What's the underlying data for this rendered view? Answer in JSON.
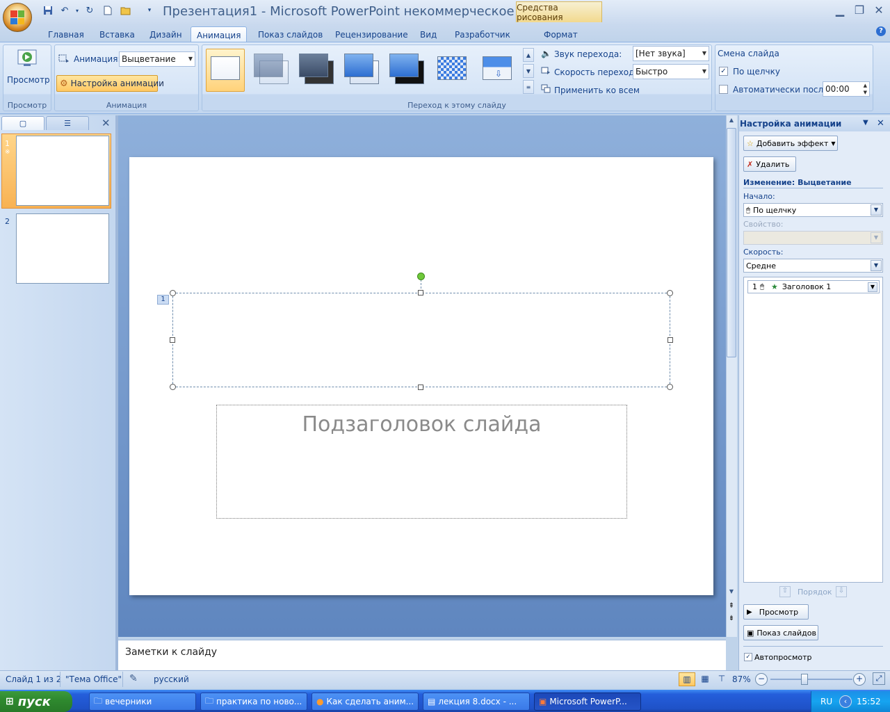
{
  "window": {
    "title": "Презентация1 - Microsoft PowerPoint некоммерческое ...",
    "contextual_tab": "Средства рисования",
    "icons": [
      "save-icon",
      "undo-icon",
      "redo-icon",
      "new-icon",
      "open-icon",
      "minimize-icon",
      "restore-icon",
      "close-icon",
      "help-icon"
    ]
  },
  "tabs": [
    "Главная",
    "Вставка",
    "Дизайн",
    "Анимация",
    "Показ слайдов",
    "Рецензирование",
    "Вид",
    "Разработчик",
    "Формат"
  ],
  "ribbon": {
    "preview_group": {
      "button": "Просмотр",
      "label": "Просмотр"
    },
    "animation_group": {
      "animation_label": "Анимация:",
      "animation_value": "Выцветание",
      "custom_button": "Настройка анимации",
      "label": "Анимация"
    },
    "transition_group": {
      "sound_label": "Звук перехода:",
      "sound_value": "[Нет звука]",
      "speed_label": "Скорость перехода:",
      "speed_value": "Быстро",
      "apply_all": "Применить ко всем",
      "label": "Переход к этому слайду"
    },
    "advance_group": {
      "title": "Смена слайда",
      "on_click": "По щелчку",
      "on_click_checked": true,
      "auto_after": "Автоматически после:",
      "auto_checked": false,
      "time": "00:00"
    }
  },
  "slides_pane": {
    "slides": [
      {
        "number": "1",
        "anim_marker": "※",
        "selected": true
      },
      {
        "number": "2",
        "selected": false
      }
    ]
  },
  "slide": {
    "anim_tag": "1",
    "subtitle_placeholder": "Подзаголовок слайда"
  },
  "notes": {
    "placeholder": "Заметки к слайду"
  },
  "task_pane": {
    "title": "Настройка анимации",
    "add_effect": "Добавить эффект",
    "remove": "Удалить",
    "change_heading": "Изменение: Выцветание",
    "start_label": "Начало:",
    "start_value": "По щелчку",
    "property_label": "Свойство:",
    "speed_label": "Скорость:",
    "speed_value": "Средне",
    "list_items": [
      {
        "index": "1",
        "name": "Заголовок 1"
      }
    ],
    "reorder_label": "Порядок",
    "play_button": "Просмотр",
    "slideshow_button": "Показ слайдов",
    "autopreview": "Автопросмотр",
    "autopreview_checked": true
  },
  "status": {
    "slide_info": "Слайд 1 из 2",
    "theme": "\"Тема Office\"",
    "language": "русский",
    "zoom": "87%"
  },
  "taskbar": {
    "start": "пуск",
    "items": [
      {
        "label": "вечерники",
        "icon": "folder-icon"
      },
      {
        "label": "практика по ново...",
        "icon": "folder-icon"
      },
      {
        "label": "Как сделать аним...",
        "icon": "browser-icon"
      },
      {
        "label": "лекция 8.docx - ...",
        "icon": "word-icon"
      },
      {
        "label": "Microsoft PowerP...",
        "icon": "powerpoint-icon",
        "active": true
      }
    ],
    "lang": "RU",
    "clock": "15:52"
  }
}
